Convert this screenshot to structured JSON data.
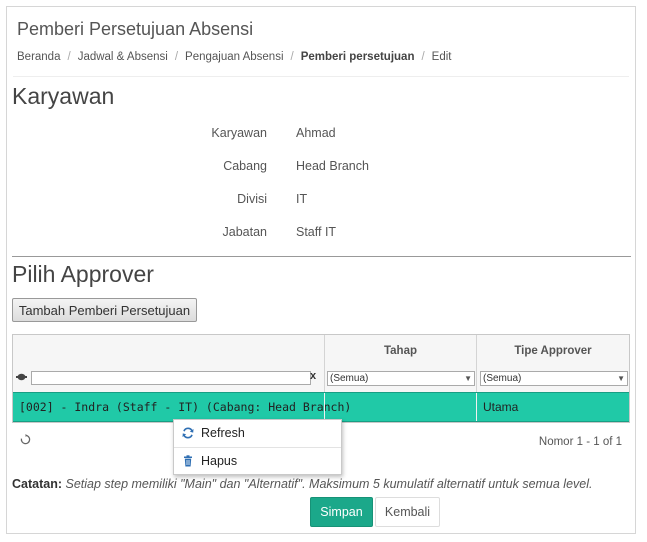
{
  "header": {
    "title": "Pemberi Persetujuan Absensi",
    "breadcrumb": [
      "Beranda",
      "Jadwal & Absensi",
      "Pengajuan Absensi",
      "Pemberi persetujuan",
      "Edit"
    ]
  },
  "employee": {
    "section_title": "Karyawan",
    "rows": [
      {
        "label": "Karyawan",
        "value": "Ahmad"
      },
      {
        "label": "Cabang",
        "value": "Head Branch"
      },
      {
        "label": "Divisi",
        "value": "IT"
      },
      {
        "label": "Jabatan",
        "value": "Staff IT"
      }
    ]
  },
  "approver": {
    "section_title": "Pilih Approver",
    "add_button_label": "Tambah Pemberi Persetujuan",
    "grid": {
      "columns": [
        "",
        "Tahap",
        "Tipe Approver"
      ],
      "filter": {
        "clear_label": "x",
        "tahap_selected": "(Semua)",
        "tipe_selected": "(Semua)"
      },
      "rows": [
        {
          "name": "[002] - Indra (Staff - IT) (Cabang: Head Branch)",
          "tahap": "",
          "tipe": "Utama"
        }
      ],
      "pager_text": "Nomor 1 - 1 of 1"
    },
    "context_menu": {
      "items": [
        {
          "label": "Refresh",
          "icon": "refresh-icon"
        },
        {
          "label": "Hapus",
          "icon": "trash-icon"
        }
      ]
    }
  },
  "note": {
    "label": "Catatan:",
    "text": "Setiap step memiliki \"Main\" dan \"Alternatif\". Maksimum 5 kumulatif alternatif untuk semua level."
  },
  "actions": {
    "save_label": "Simpan",
    "back_label": "Kembali"
  },
  "colors": {
    "accent": "#1ba88a",
    "selected_row": "#20c9a7"
  }
}
